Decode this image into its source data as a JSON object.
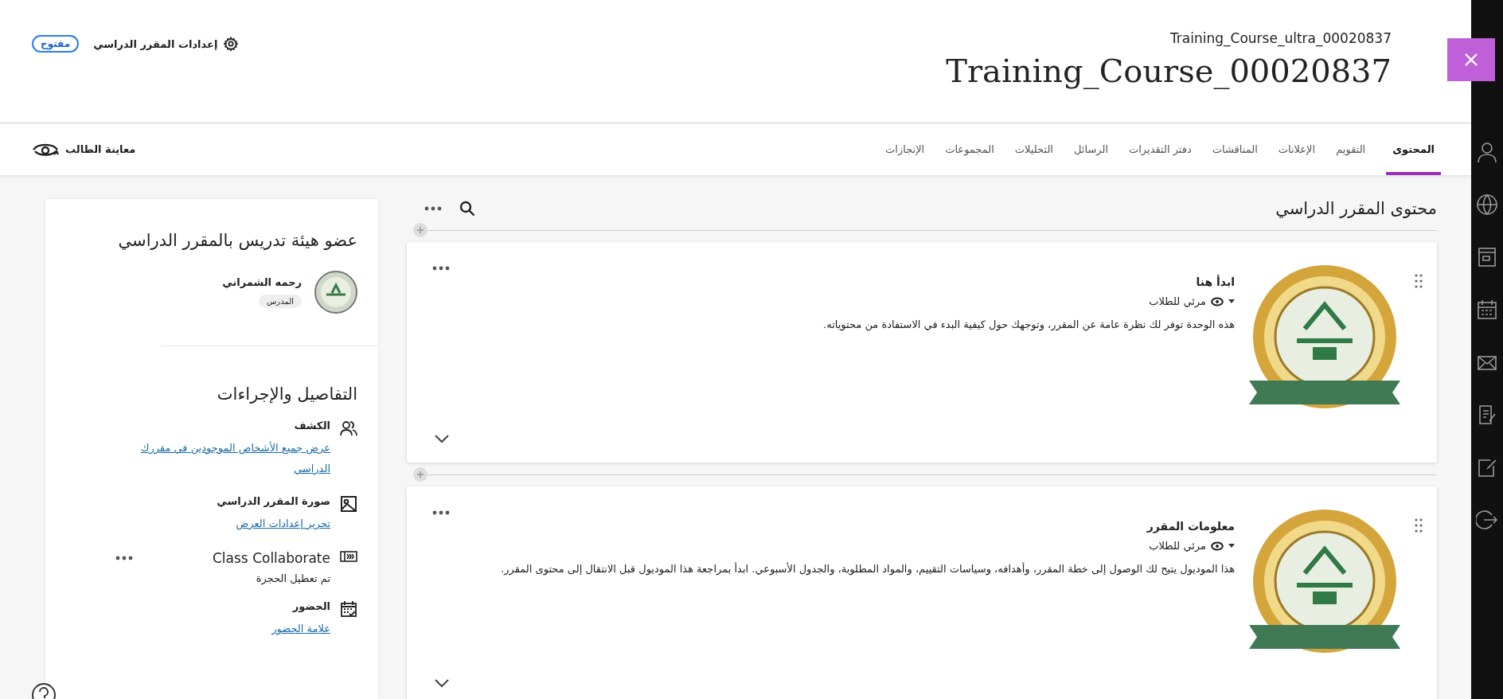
{
  "header": {
    "course_code": "Training_Course_ultra_00020837",
    "course_title": "Training_Course_00020837",
    "settings_label": "إعدادات المقرر الدراسي",
    "status_badge": "مفتوح"
  },
  "nav": {
    "tabs": [
      {
        "label": "المحتوى",
        "selected": true
      },
      {
        "label": "التقويم",
        "selected": false
      },
      {
        "label": "الإعلانات",
        "selected": false
      },
      {
        "label": "المناقشات",
        "selected": false
      },
      {
        "label": "دفتر التقديرات",
        "selected": false
      },
      {
        "label": "الرسائل",
        "selected": false
      },
      {
        "label": "التحليلات",
        "selected": false
      },
      {
        "label": "المجموعات",
        "selected": false
      },
      {
        "label": "الإنجازات",
        "selected": false
      }
    ],
    "student_preview": "معاينة الطالب"
  },
  "content": {
    "heading": "محتوى المقرر الدراسي",
    "items": [
      {
        "title": "ابدأ هنا",
        "visibility": "مرئي للطلاب",
        "description": "هذه الوحدة توفر لك نظرة عامة عن المقرر، وتوجهك حول كيفية البدء في الاستفادة من محتوياته."
      },
      {
        "title": "معلومات المقرر",
        "visibility": "مرئي للطلاب",
        "description": "هذا الموديول يتيح لك الوصول إلى خطة المقرر، وأهدافه، وسياسات التقييم، والمواد المطلوبة، والجدول الأسبوعي. ابدأ بمراجعة هذا الموديول قبل الانتقال إلى محتوى المقرر."
      }
    ]
  },
  "side_panel": {
    "instructors_heading": "عضو هيئة تدريس بالمقرر الدراسي",
    "instructors": [
      {
        "name": "رحمه الشمراني",
        "role": "المدرس"
      }
    ],
    "details_heading": "التفاصيل والإجراءات",
    "details": [
      {
        "kind": "link",
        "title": "الكشف",
        "text": "عرض جميع الأشخاص الموجودين في مقررك الدراسي"
      },
      {
        "kind": "link",
        "title": "صورة المقرر الدراسي",
        "text": "تحرير إعدادات العرض"
      },
      {
        "kind": "status",
        "title": "Class Collaborate",
        "text": "تم تعطيل الحجرة"
      },
      {
        "kind": "link",
        "title": "الحضور",
        "text": "علامة الحضور"
      }
    ]
  }
}
